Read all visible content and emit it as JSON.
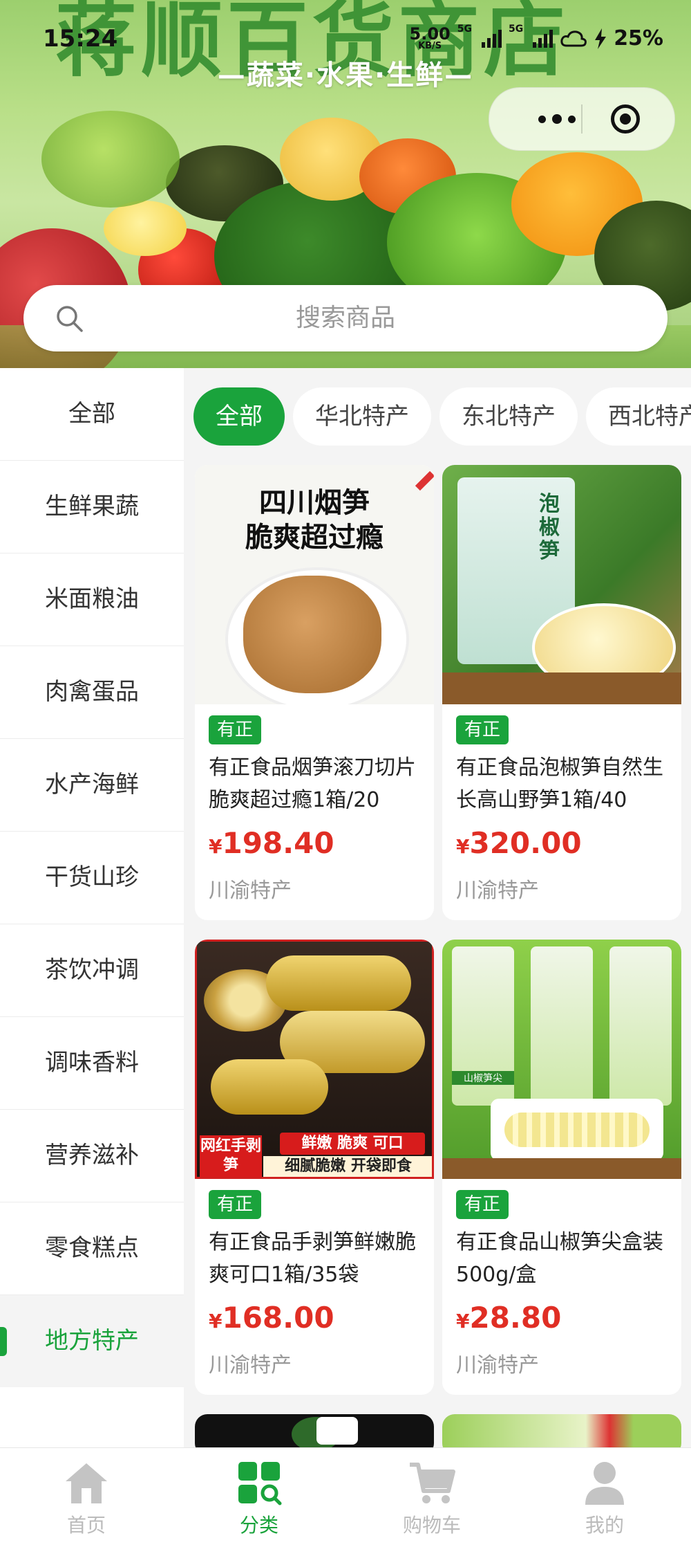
{
  "status_bar": {
    "time": "15:24",
    "net_speed": "5.00",
    "net_unit": "KB/S",
    "signal_1_label": "5G",
    "signal_2_label": "5G",
    "battery": "25%"
  },
  "banner": {
    "big_text": "蒋顺百货商店",
    "subtitle": "—蔬菜·水果·生鲜—"
  },
  "search": {
    "placeholder": "搜索商品"
  },
  "sidebar": {
    "items": [
      {
        "label": "全部"
      },
      {
        "label": "生鲜果蔬"
      },
      {
        "label": "米面粮油"
      },
      {
        "label": "肉禽蛋品"
      },
      {
        "label": "水产海鲜"
      },
      {
        "label": "干货山珍"
      },
      {
        "label": "茶饮冲调"
      },
      {
        "label": "调味香料"
      },
      {
        "label": "营养滋补"
      },
      {
        "label": "零食糕点"
      },
      {
        "label": "地方特产"
      }
    ],
    "active_index": 10
  },
  "tabs": [
    {
      "label": "全部",
      "active": true
    },
    {
      "label": "华北特产"
    },
    {
      "label": "东北特产"
    },
    {
      "label": "西北特产"
    }
  ],
  "products": [
    {
      "brand": "有正",
      "name": "有正食品烟笋滚刀切片脆爽超过瘾1箱/20",
      "currency": "¥",
      "price": "198.40",
      "origin": "川渝特产",
      "image_text_1": "四川烟笋",
      "image_text_2": "脆爽超过瘾"
    },
    {
      "brand": "有正",
      "name": "有正食品泡椒笋自然生长高山野笋1箱/40",
      "currency": "¥",
      "price": "320.00",
      "origin": "川渝特产",
      "image_text_1": "泡椒笋"
    },
    {
      "brand": "有正",
      "name": "有正食品手剥笋鲜嫩脆爽可口1箱/35袋",
      "currency": "¥",
      "price": "168.00",
      "origin": "川渝特产",
      "image_text_1": "网红手剥笋",
      "image_text_2": "鲜嫩 脆爽 可口",
      "image_text_3": "细腻脆嫩 开袋即食"
    },
    {
      "brand": "有正",
      "name": "有正食品山椒笋尖盒装500g/盒",
      "currency": "¥",
      "price": "28.80",
      "origin": "川渝特产",
      "image_text_1": "山椒笋尖"
    }
  ],
  "tabbar": [
    {
      "label": "首页",
      "icon": "home-icon"
    },
    {
      "label": "分类",
      "icon": "category-icon",
      "active": true
    },
    {
      "label": "购物车",
      "icon": "cart-icon"
    },
    {
      "label": "我的",
      "icon": "user-icon"
    }
  ],
  "colors": {
    "accent": "#1aa33c",
    "price": "#e02e24",
    "muted": "#999999"
  }
}
